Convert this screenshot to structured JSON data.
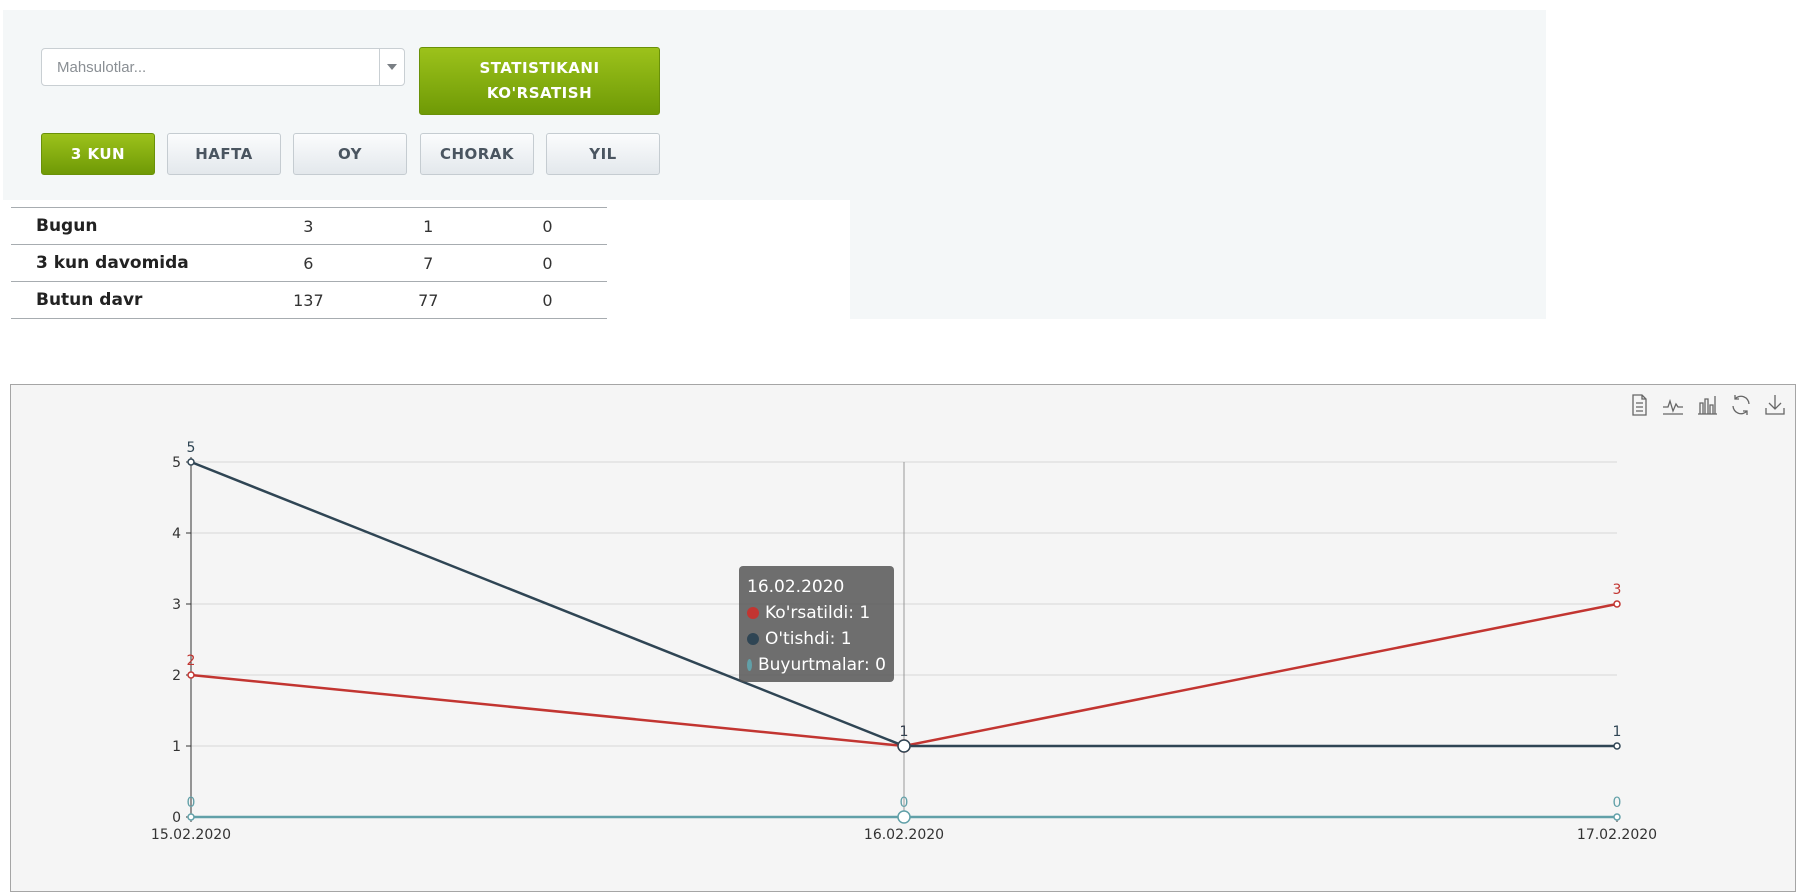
{
  "filter": {
    "product_placeholder": "Mahsulotlar...",
    "show_stats_label_line1": "STATISTIKANI",
    "show_stats_label_line2": "KO'RSATISH",
    "periods": [
      {
        "label": "3 KUN",
        "active": true
      },
      {
        "label": "HAFTA",
        "active": false
      },
      {
        "label": "OY",
        "active": false
      },
      {
        "label": "CHORAK",
        "active": false
      },
      {
        "label": "YIL",
        "active": false
      }
    ]
  },
  "stats_table": {
    "rows": [
      {
        "label": "Bugun",
        "values": [
          "3",
          "1",
          "0"
        ]
      },
      {
        "label": "3 kun davomida",
        "values": [
          "6",
          "7",
          "0"
        ]
      },
      {
        "label": "Butun davr",
        "values": [
          "137",
          "77",
          "0"
        ]
      }
    ]
  },
  "toolbox_icons": [
    "data-view-icon",
    "line-chart-icon",
    "bar-chart-icon",
    "restore-icon",
    "download-icon"
  ],
  "chart_data": {
    "type": "line",
    "x": [
      "15.02.2020",
      "16.02.2020",
      "17.02.2020"
    ],
    "ylim": [
      0,
      5
    ],
    "yticks": [
      0,
      1,
      2,
      3,
      4,
      5
    ],
    "grid": true,
    "series": [
      {
        "name": "Ko'rsatildi",
        "color": "#c23531",
        "values": [
          2,
          1,
          3
        ]
      },
      {
        "name": "O'tishdi",
        "color": "#2f4554",
        "values": [
          5,
          1,
          1
        ]
      },
      {
        "name": "Buyurtmalar",
        "color": "#61a0a8",
        "values": [
          0,
          0,
          0
        ]
      }
    ],
    "tooltip": {
      "title": "16.02.2020",
      "items": [
        {
          "name": "Ko'rsatildi",
          "value": "1",
          "color": "#c23531"
        },
        {
          "name": "O'tishdi",
          "value": "1",
          "color": "#2f4554"
        },
        {
          "name": "Buyurtmalar",
          "value": "0",
          "color": "#61a0a8"
        }
      ]
    }
  }
}
